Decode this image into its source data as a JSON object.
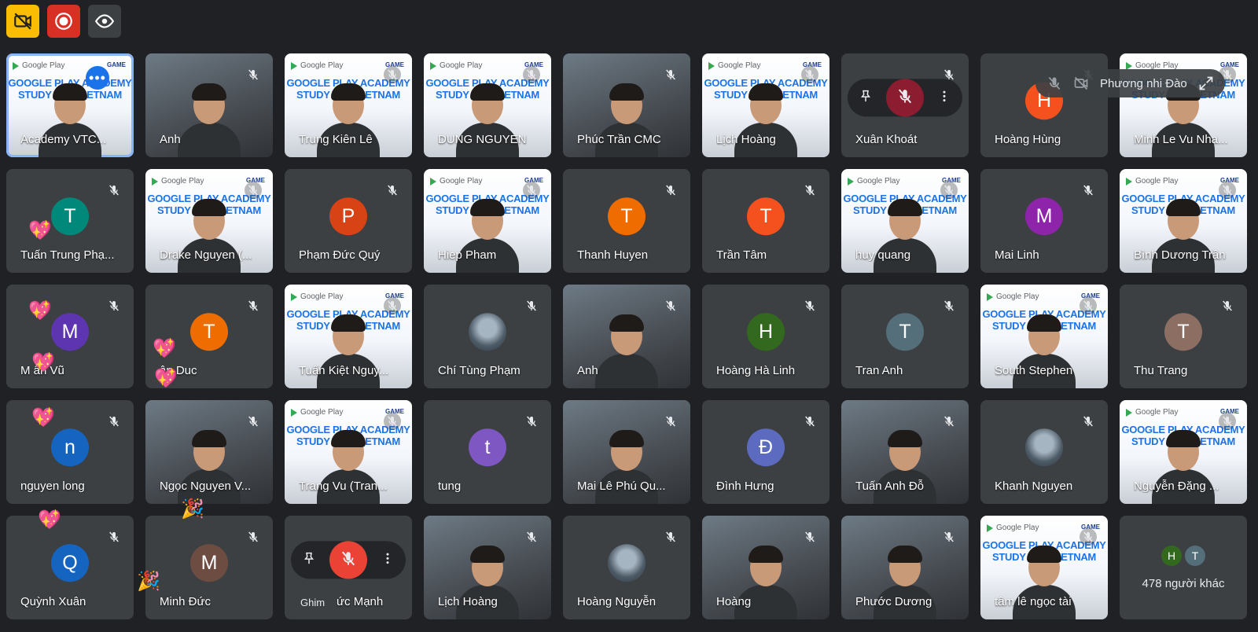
{
  "colors": {
    "background": "#202124",
    "tile": "#3c4043",
    "selected_outline": "#8ab4f8",
    "mic_muted": "#e8eaed",
    "red": "#ea4335"
  },
  "toolbar": [
    {
      "icon": "no-video-icon",
      "bg": "#fbbc04"
    },
    {
      "icon": "record-icon",
      "bg": "#d93025"
    },
    {
      "icon": "eye-icon",
      "bg": "#3c4043"
    }
  ],
  "participants": [
    {
      "name": "Academy VTC...",
      "type": "gp",
      "selected": true,
      "more_button": true
    },
    {
      "name": "Anh",
      "type": "video"
    },
    {
      "name": "Trung Kiên Lê",
      "type": "gp"
    },
    {
      "name": "DUNG NGUYEN",
      "type": "gp"
    },
    {
      "name": "Phúc Trần CMC",
      "type": "video"
    },
    {
      "name": "Lịch Hoàng",
      "type": "gp"
    },
    {
      "name": "Xuân Khoát",
      "type": "hover"
    },
    {
      "name": "Hoàng Hùng",
      "type": "avatar",
      "letter": "H",
      "color": "#f4511e"
    },
    {
      "name": "Minh Le Vu Nha...",
      "type": "gp"
    },
    {
      "name": "Tuấn Trung Phạ...",
      "type": "avatar",
      "letter": "T",
      "color": "#00897b"
    },
    {
      "name": "Drake Nguyen (...",
      "type": "gp"
    },
    {
      "name": "Phạm Đức Quý",
      "type": "avatar",
      "letter": "P",
      "color": "#d84315"
    },
    {
      "name": "Hiep Pham",
      "type": "gp"
    },
    {
      "name": "Thanh Huyen",
      "type": "avatar",
      "letter": "T",
      "color": "#ef6c00"
    },
    {
      "name": "Trần Tâm",
      "type": "avatar",
      "letter": "T",
      "color": "#f4511e"
    },
    {
      "name": "huy quang",
      "type": "gp"
    },
    {
      "name": "Mai Linh",
      "type": "avatar",
      "letter": "M",
      "color": "#8e24aa"
    },
    {
      "name": "Bình Dương Trần",
      "type": "gp"
    },
    {
      "name": "M ân Vũ",
      "type": "avatar",
      "letter": "M",
      "color": "#5e35b1"
    },
    {
      "name": "ân Duc",
      "type": "avatar",
      "letter": "T",
      "color": "#ef6c00"
    },
    {
      "name": "Tuấn Kiệt Nguy...",
      "type": "gp"
    },
    {
      "name": "Chí Tùng Phạm",
      "type": "photo"
    },
    {
      "name": "Anh",
      "type": "video"
    },
    {
      "name": "Hoàng Hà Linh",
      "type": "avatar",
      "letter": "H",
      "color": "#33691e"
    },
    {
      "name": "Tran Anh",
      "type": "avatar",
      "letter": "T",
      "color": "#546e7a"
    },
    {
      "name": "South Stephen",
      "type": "gp"
    },
    {
      "name": "Thu Trang",
      "type": "avatar",
      "letter": "T",
      "color": "#8d6e63"
    },
    {
      "name": "nguyen long",
      "type": "avatar",
      "letter": "n",
      "color": "#1565c0"
    },
    {
      "name": "Ngọc Nguyen V...",
      "type": "video"
    },
    {
      "name": "Trang Vu (Tran...",
      "type": "gp"
    },
    {
      "name": "tung",
      "type": "avatar",
      "letter": "t",
      "color": "#7e57c2"
    },
    {
      "name": "Mai Lê Phú Qu...",
      "type": "video"
    },
    {
      "name": "Đình Hưng",
      "type": "avatar",
      "letter": "Đ",
      "color": "#5c6bc0"
    },
    {
      "name": "Tuấn Anh Đỗ",
      "type": "video"
    },
    {
      "name": "Khanh Nguyen",
      "type": "photo"
    },
    {
      "name": "Nguyễn Đặng ...",
      "type": "gp"
    },
    {
      "name": "Quỳnh Xuân",
      "type": "avatar",
      "letter": "Q",
      "color": "#1565c0"
    },
    {
      "name": "Minh Đức",
      "type": "avatar",
      "letter": "M",
      "color": "#6d4c41"
    },
    {
      "name": "ức Mạnh",
      "type": "hover",
      "tooltip": "Ghim"
    },
    {
      "name": "Lịch Hoàng",
      "type": "video"
    },
    {
      "name": "Hoàng Nguyễn",
      "type": "photo"
    },
    {
      "name": "Hoàng",
      "type": "video"
    },
    {
      "name": "Phước Dương",
      "type": "video"
    },
    {
      "name": "tâm lê ngọc tài",
      "type": "gp"
    },
    {
      "name": "others",
      "type": "others"
    }
  ],
  "gp_tile": {
    "brand": "Google Play",
    "title_line1": "GOOGLE PLAY ACADEMY",
    "title_line2": "STUDY JAM VIETNAM",
    "logo": "GAME"
  },
  "status_pill": {
    "name": "Phương nhi Đào"
  },
  "others": {
    "count_label": "478 người khác",
    "avatars": [
      {
        "letter": "H",
        "color": "#33691e"
      },
      {
        "letter": "T",
        "color": "#546e7a"
      }
    ]
  },
  "reactions": [
    "💖",
    "💖",
    "💖",
    "💖",
    "💖",
    "💖",
    "💖",
    "🎉",
    "🎉"
  ]
}
